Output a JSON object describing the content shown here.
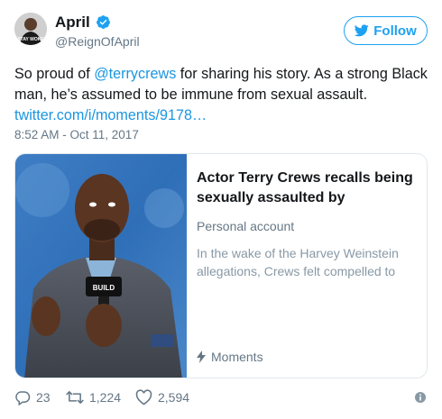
{
  "author": {
    "name": "April",
    "handle": "@ReignOfApril",
    "avatar_text": "STAY WOKE"
  },
  "follow": {
    "label": "Follow"
  },
  "tweet": {
    "text_before": "So proud of ",
    "mention": "@terrycrews",
    "text_after": " for sharing his story. As a strong Black man, he’s assumed to be immune from sexual assault.",
    "link": "twitter.com/i/moments/9178…",
    "timestamp": "8:52 AM - Oct 11, 2017"
  },
  "card": {
    "title": "Actor Terry Crews recalls being sexually assaulted by",
    "subtitle": "Personal account",
    "description": "In the wake of the Harvey Weinstein allegations, Crews felt compelled to",
    "source": "Moments",
    "mic_text": "BUILD"
  },
  "actions": {
    "replies": "23",
    "retweets": "1,224",
    "likes": "2,594"
  },
  "colors": {
    "accent": "#1da1f2",
    "link": "#1b95e0",
    "muted": "#657786",
    "border": "#e1e8ed"
  },
  "icons": [
    "verified-badge-icon",
    "twitter-bird-icon",
    "lightning-icon",
    "reply-icon",
    "retweet-icon",
    "heart-icon",
    "info-icon"
  ]
}
